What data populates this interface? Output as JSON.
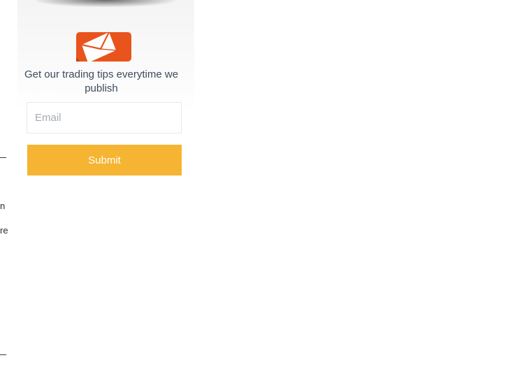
{
  "subscribe_widget": {
    "icon": "envelope-icon",
    "tagline": "Get our trading tips everytime we publish",
    "email_placeholder": "Email",
    "submit_label": "Submit"
  },
  "left_edge_fragments": {
    "fragment_1": "n",
    "fragment_2": "re"
  },
  "colors": {
    "submit_background": "#f5b431",
    "envelope_orange": "#e8541c",
    "tagline_text": "#3d4a5c"
  }
}
